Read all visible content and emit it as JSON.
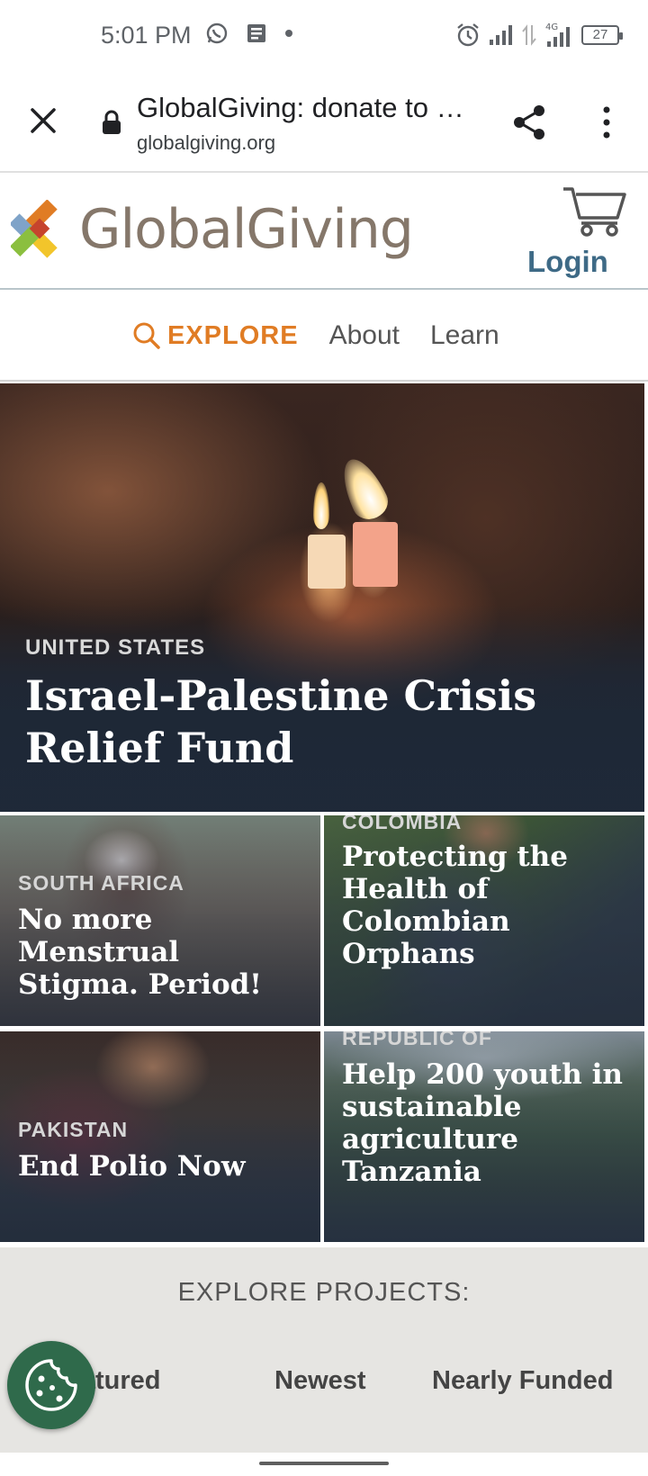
{
  "status_bar": {
    "time": "5:01 PM",
    "battery": "27",
    "network": "4G"
  },
  "browser": {
    "title": "GlobalGiving: donate to …",
    "url": "globalgiving.org"
  },
  "site": {
    "logo_text": "GlobalGiving",
    "login_label": "Login",
    "nav": {
      "explore_label": "EXPLORE",
      "about_label": "About",
      "learn_label": "Learn"
    }
  },
  "hero": {
    "country": "UNITED STATES",
    "title": "Israel-Palestine Crisis Relief Fund"
  },
  "projects": [
    {
      "country": "SOUTH AFRICA",
      "title": "No more Menstrual Stigma. Period!"
    },
    {
      "country": "COLOMBIA",
      "title": "Protecting the Health of Colombian Orphans"
    },
    {
      "country": "PAKISTAN",
      "title": "End Polio Now"
    },
    {
      "country": "REPUBLIC OF",
      "title": "Help 200 youth in sustainable agriculture Tanzania"
    }
  ],
  "explore_projects": {
    "heading": "EXPLORE PROJECTS:",
    "tabs": [
      "Featured",
      "Newest",
      "Nearly Funded"
    ]
  },
  "colors": {
    "accent_orange": "#e07c24",
    "login_blue": "#3e6a86",
    "logo_brown": "#85776a",
    "cookie_green": "#2f6a4b"
  }
}
